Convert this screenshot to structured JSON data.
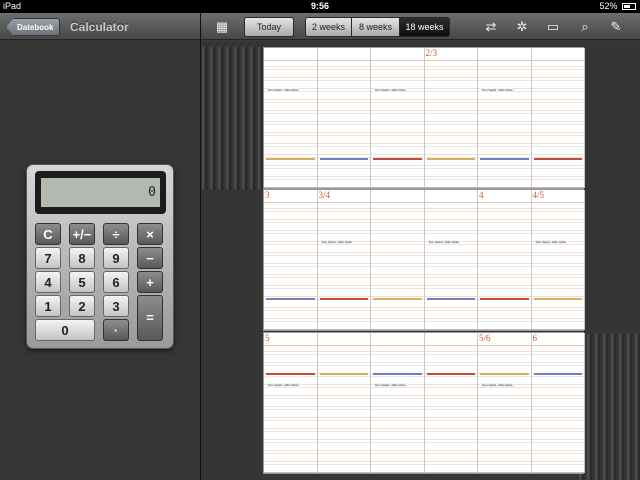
{
  "status": {
    "device": "iPad",
    "time": "9:56",
    "battery": "52%"
  },
  "left": {
    "back_label": "Datebook",
    "title": "Calculator"
  },
  "toolbar": {
    "today": "Today",
    "w2": "2 weeks",
    "w8": "8 weeks",
    "w18": "18 weeks"
  },
  "calculator": {
    "display": "0",
    "keys": [
      [
        "C",
        "+/−",
        "÷",
        "×"
      ],
      [
        "7",
        "8",
        "9",
        "−"
      ],
      [
        "4",
        "5",
        "6",
        "+"
      ],
      [
        "1",
        "2",
        "3",
        "="
      ],
      [
        "0",
        "·"
      ]
    ]
  },
  "calendar": {
    "blocks": [
      {
        "first_day": "2/3"
      },
      {
        "first_day": "3"
      },
      {
        "first_day": "5"
      }
    ],
    "day_numbers": [
      [
        "",
        "",
        "",
        "2/3",
        "",
        ""
      ],
      [
        "3",
        "3/4",
        "",
        "",
        "4",
        "4/5"
      ],
      [
        "5",
        "",
        "",
        "",
        "5/6",
        "6"
      ]
    ],
    "events": [
      "Tom Sekid - Dillo Ghite"
    ]
  }
}
